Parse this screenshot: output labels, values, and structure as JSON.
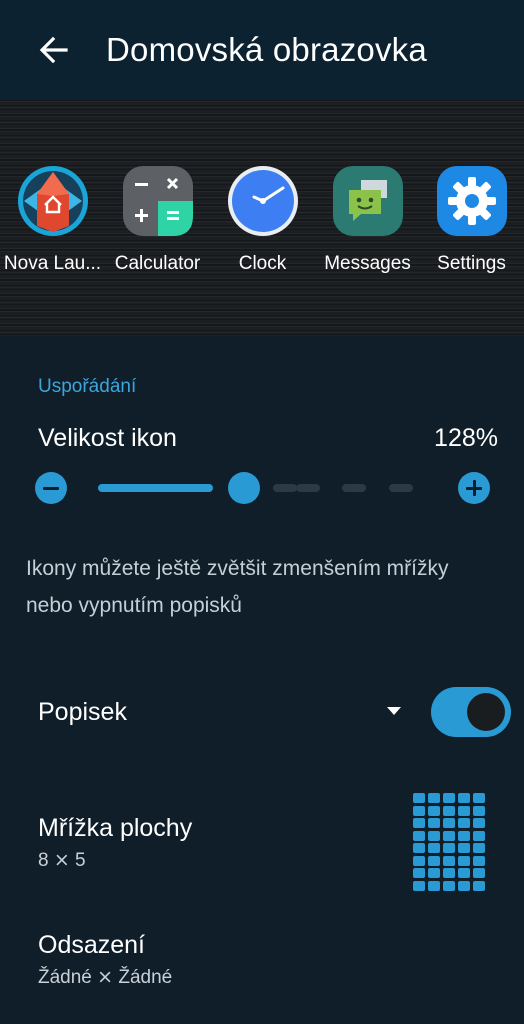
{
  "header": {
    "title": "Domovská obrazovka",
    "back_icon": "arrow-left-icon"
  },
  "preview": {
    "apps": [
      {
        "label": "Nova Lau...",
        "icon": "nova-launcher-icon"
      },
      {
        "label": "Calculator",
        "icon": "calculator-icon"
      },
      {
        "label": "Clock",
        "icon": "clock-icon"
      },
      {
        "label": "Messages",
        "icon": "messages-icon"
      },
      {
        "label": "Settings",
        "icon": "settings-gear-icon"
      }
    ]
  },
  "arrangement": {
    "section_title": "Uspořádání",
    "icon_size": {
      "label": "Velikost ikon",
      "value": "128%",
      "slider_fraction": 0.45
    },
    "hint": "Ikony můžete ještě zvětšit zmenšením mřížky nebo vypnutím popisků"
  },
  "label_row": {
    "title": "Popisek",
    "toggle_on": true
  },
  "grid_row": {
    "title": "Mřížka plochy",
    "value": "8 ⨯ 5"
  },
  "padding_row": {
    "title": "Odsazení",
    "value": "Žádné ⨯ Žádné"
  },
  "colors": {
    "accent": "#2a9ad4",
    "background": "#0f1e29",
    "appbar": "#0c2230"
  }
}
